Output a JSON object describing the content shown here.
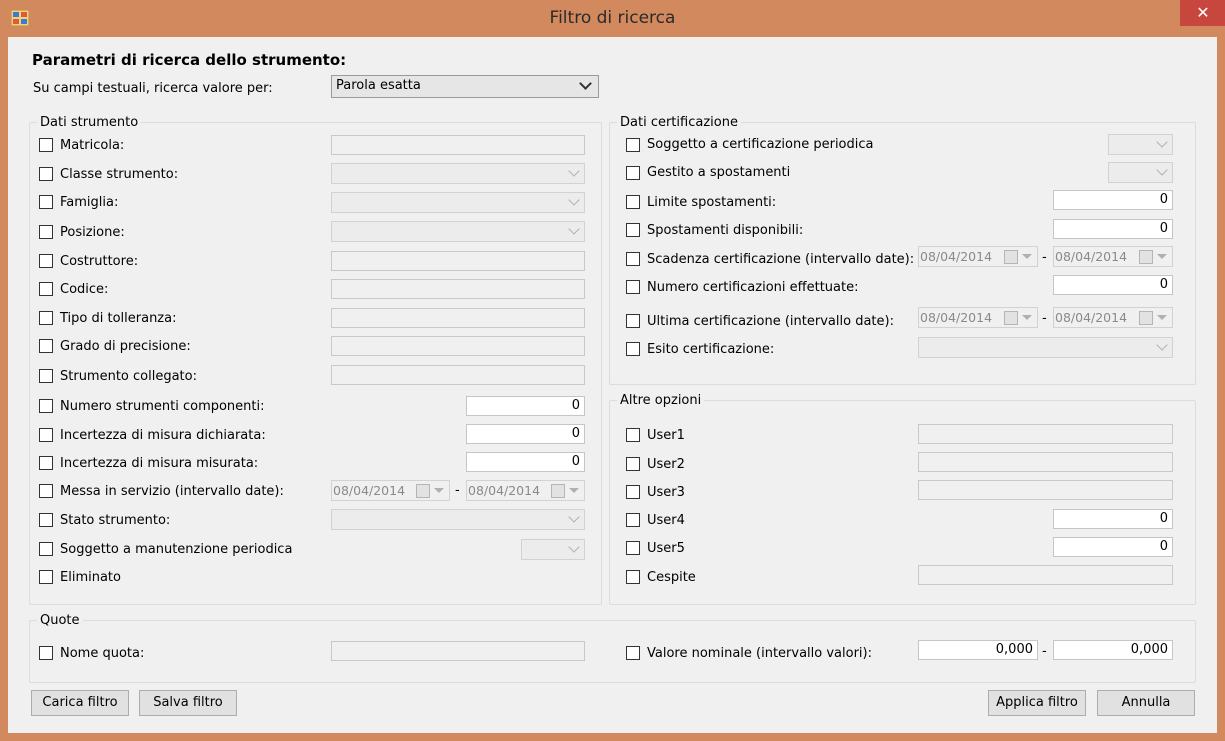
{
  "window": {
    "title": "Filtro di ricerca",
    "close_glyph": "✕"
  },
  "heading": "Parametri di ricerca dello strumento:",
  "search_mode": {
    "label": "Su campi testuali, ricerca valore per:",
    "value": "Parola esatta"
  },
  "dati_strumento": {
    "title": "Dati strumento",
    "matricola": "Matricola:",
    "classe": "Classe strumento:",
    "famiglia": "Famiglia:",
    "posizione": "Posizione:",
    "costruttore": "Costruttore:",
    "codice": "Codice:",
    "tolleranza": "Tipo di tolleranza:",
    "precisione": "Grado di precisione:",
    "collegato": "Strumento collegato:",
    "num_componenti": {
      "label": "Numero strumenti componenti:",
      "value": "0"
    },
    "inc_dichiarata": {
      "label": "Incertezza di misura dichiarata:",
      "value": "0"
    },
    "inc_misurata": {
      "label": "Incertezza di misura misurata:",
      "value": "0"
    },
    "servizio": {
      "label": "Messa in servizio (intervallo date):",
      "from": "08/04/2014",
      "to": "08/04/2014"
    },
    "stato": "Stato strumento:",
    "manutenzione": "Soggetto a manutenzione periodica",
    "eliminato": "Eliminato"
  },
  "dati_certificazione": {
    "title": "Dati certificazione",
    "periodica": "Soggetto a certificazione periodica",
    "spostamenti": "Gestito a spostamenti",
    "limite": {
      "label": "Limite spostamenti:",
      "value": "0"
    },
    "disponibili": {
      "label": "Spostamenti disponibili:",
      "value": "0"
    },
    "scadenza": {
      "label": "Scadenza certificazione (intervallo date):",
      "from": "08/04/2014",
      "to": "08/04/2014"
    },
    "numero": {
      "label": "Numero certificazioni effettuate:",
      "value": "0"
    },
    "ultima": {
      "label": "Ultima certificazione (intervallo date):",
      "from": "08/04/2014",
      "to": "08/04/2014"
    },
    "esito": "Esito certificazione:"
  },
  "altre_opzioni": {
    "title": "Altre opzioni",
    "user1": "User1",
    "user2": "User2",
    "user3": "User3",
    "user4": {
      "label": "User4",
      "value": "0"
    },
    "user5": {
      "label": "User5",
      "value": "0"
    },
    "cespite": "Cespite"
  },
  "quote": {
    "title": "Quote",
    "nome": "Nome quota:",
    "valore": {
      "label": "Valore nominale (intervallo valori):",
      "from": "0,000",
      "to": "0,000"
    }
  },
  "range_separator": "-",
  "buttons": {
    "carica": "Carica filtro",
    "salva": "Salva filtro",
    "applica": "Applica filtro",
    "annulla": "Annulla"
  },
  "colors": {
    "window_border": "#d2895e",
    "close_button": "#c7463d",
    "client_bg": "#f0f0f0"
  }
}
